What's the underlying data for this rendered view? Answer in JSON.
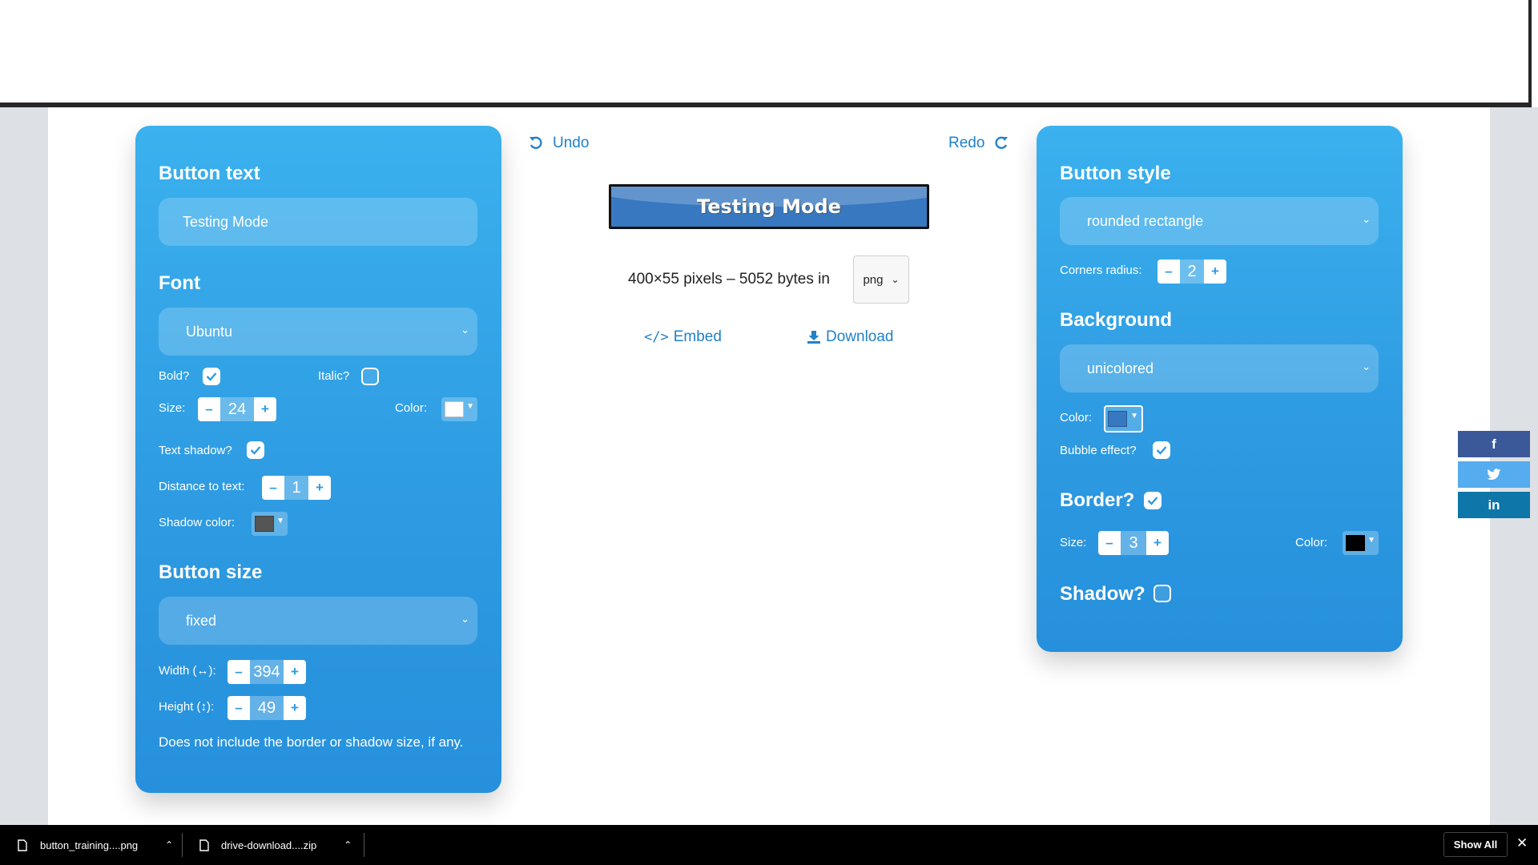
{
  "colors": {
    "panel": "#2e9be2",
    "link": "#2181c9",
    "button_bg": "#3778c0",
    "border": "#111111",
    "shadow_color": "#555555",
    "facebook": "#3b5998",
    "twitter": "#55acee",
    "linkedin": "#0e76a8"
  },
  "icons": {
    "undo": "undo-icon",
    "redo": "redo-icon",
    "embed": "code-icon",
    "download": "download-icon",
    "facebook": "facebook-icon",
    "twitter": "twitter-icon",
    "linkedin": "linkedin-icon",
    "file": "file-icon",
    "close": "close-icon"
  },
  "left": {
    "button_text_heading": "Button text",
    "button_text_value": "Testing Mode",
    "font_heading": "Font",
    "font_value": "Ubuntu",
    "bold_label": "Bold?",
    "bold_checked": true,
    "italic_label": "Italic?",
    "italic_checked": false,
    "size_label": "Size:",
    "size_value": "24",
    "color_label": "Color:",
    "text_shadow_label": "Text shadow?",
    "text_shadow_checked": true,
    "distance_label": "Distance to text:",
    "distance_value": "1",
    "shadow_color_label": "Shadow color:",
    "size_heading": "Button size",
    "size_mode": "fixed",
    "width_label": "Width (↔):",
    "width_value": "394",
    "height_label": "Height (↕):",
    "height_value": "49",
    "note": "Does not include the border or shadow size, if any."
  },
  "center": {
    "undo_label": "Undo",
    "redo_label": "Redo",
    "preview_text": "Testing Mode",
    "info_text": "400×55 pixels – 5052 bytes in",
    "format": "png",
    "embed_label": "Embed",
    "download_label": "Download"
  },
  "right": {
    "style_heading": "Button style",
    "style_value": "rounded rectangle",
    "corners_label": "Corners radius:",
    "corners_value": "2",
    "background_heading": "Background",
    "background_value": "unicolored",
    "color_label": "Color:",
    "bubble_label": "Bubble effect?",
    "bubble_checked": true,
    "border_heading": "Border?",
    "border_checked": true,
    "border_size_label": "Size:",
    "border_size_value": "3",
    "border_color_label": "Color:",
    "shadow_heading": "Shadow?",
    "shadow_checked": false
  },
  "social": {
    "facebook": "f",
    "linkedin": "in"
  },
  "downloads": {
    "item1": "button_training....png",
    "item2": "drive-download....zip",
    "show_all": "Show All"
  }
}
